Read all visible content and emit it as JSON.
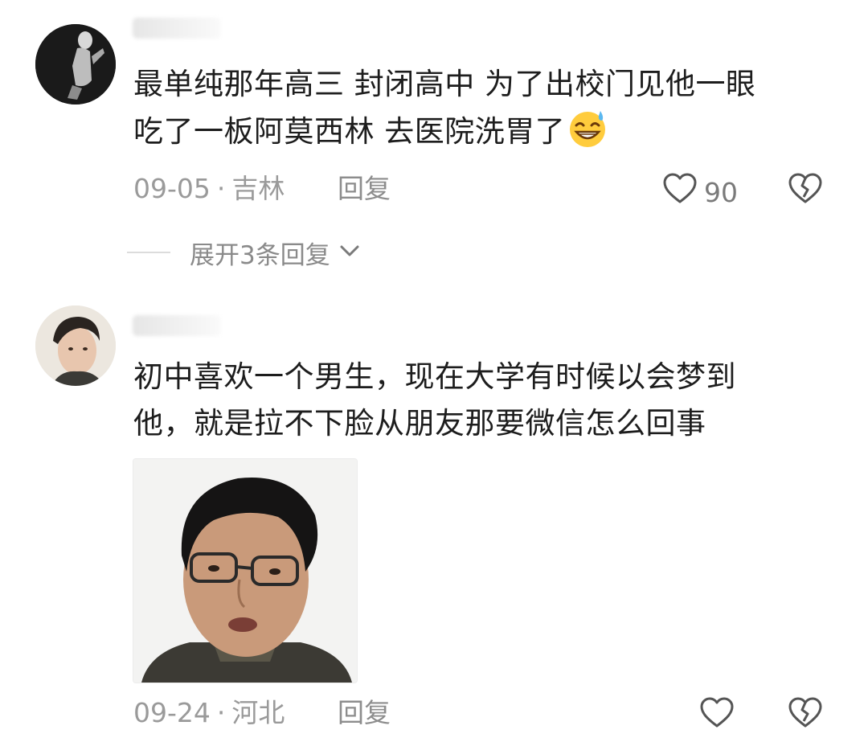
{
  "comments": [
    {
      "text_line1": "最单纯那年高三 封闭高中 为了出校门见他一眼",
      "text_line2": "吃了一板阿莫西林 去医院洗胃了",
      "emoji": "grinning-sweat-emoji",
      "date": "09-05",
      "separator": "·",
      "location": "吉林",
      "reply_label": "回复",
      "like_count": "90",
      "expand_label": "展开3条回复"
    },
    {
      "text_line1": "初中喜欢一个男生，现在大学有时候以会梦到",
      "text_line2": "他，就是拉不下脸从朋友那要微信怎么回事",
      "date": "09-24",
      "separator": "·",
      "location": "河北",
      "reply_label": "回复",
      "like_count": ""
    }
  ],
  "icons": {
    "like": "heart-outline-icon",
    "dislike": "broken-heart-icon",
    "expand": "chevron-down-icon"
  },
  "colors": {
    "text": "#1d1d1d",
    "meta": "#9a9a9a",
    "icon": "#555555"
  }
}
